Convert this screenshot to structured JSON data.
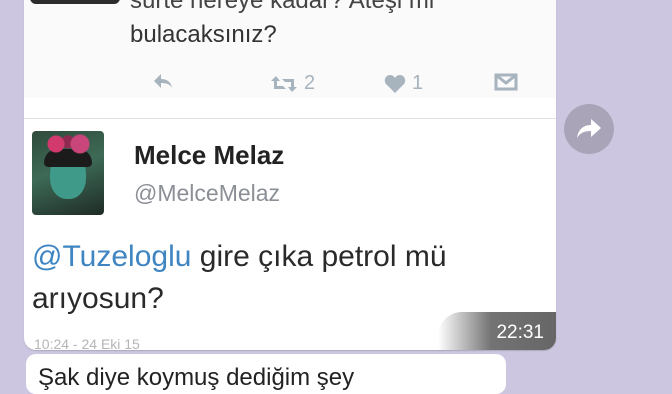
{
  "previous_tweet": {
    "line1": "sürte nereye kadar? Ateşi mi",
    "line2": "bulacaksınız?",
    "retweet_count": "2",
    "like_count": "1"
  },
  "tweet": {
    "author_name": "Melce Melaz",
    "author_handle": "@MelceMelaz",
    "mention": "@Tuzeloglu",
    "text_rest": " gire çıka petrol mü",
    "text_line2": "arıyosun?",
    "date_partial": "10:24 - 24 Eki 15"
  },
  "message": {
    "time": "22:31"
  },
  "next_message": {
    "text": "Şak diye koymuş dediğim şey"
  },
  "icons": {
    "reply": "reply-icon",
    "retweet": "retweet-icon",
    "like": "heart-icon",
    "dm": "dm-icon",
    "forward": "forward-icon"
  },
  "colors": {
    "background": "#cdc6e0",
    "mention": "#3f85c2",
    "action_gray": "#a7b3bd"
  }
}
